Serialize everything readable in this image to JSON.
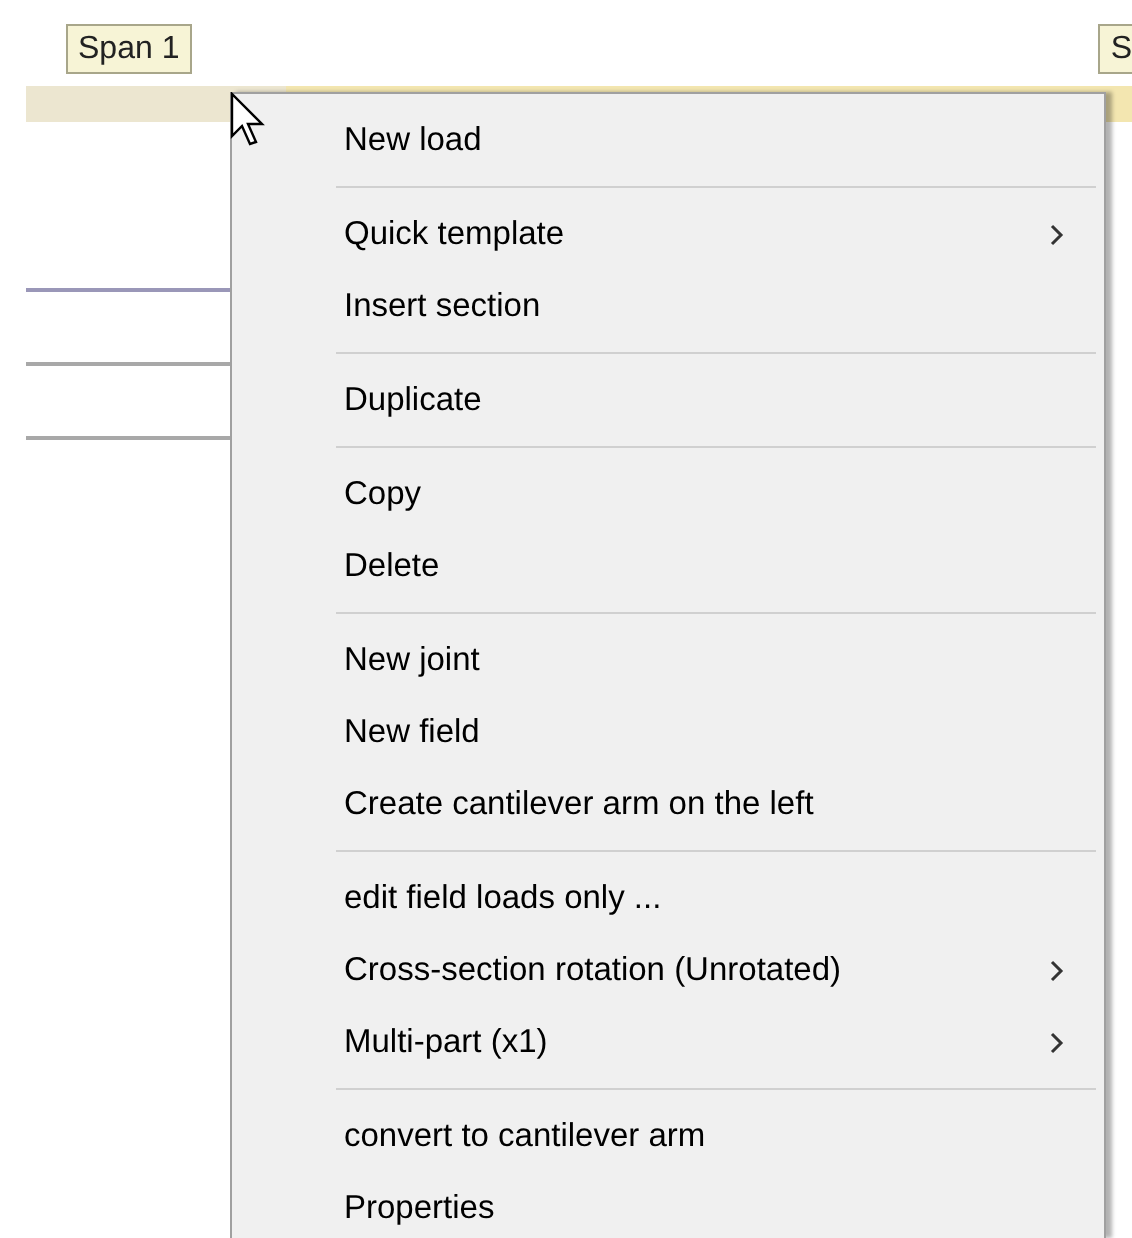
{
  "span_tags": [
    {
      "label": "Span 1"
    },
    {
      "label": "S"
    }
  ],
  "context_menu": {
    "items": [
      {
        "kind": "item",
        "label": "New load",
        "submenu": false
      },
      {
        "kind": "separator"
      },
      {
        "kind": "item",
        "label": "Quick template",
        "submenu": true
      },
      {
        "kind": "item",
        "label": "Insert section",
        "submenu": false
      },
      {
        "kind": "separator"
      },
      {
        "kind": "item",
        "label": "Duplicate",
        "submenu": false
      },
      {
        "kind": "separator"
      },
      {
        "kind": "item",
        "label": "Copy",
        "submenu": false
      },
      {
        "kind": "item",
        "label": "Delete",
        "submenu": false
      },
      {
        "kind": "separator"
      },
      {
        "kind": "item",
        "label": "New joint",
        "submenu": false
      },
      {
        "kind": "item",
        "label": "New field",
        "submenu": false
      },
      {
        "kind": "item",
        "label": "Create cantilever arm on the left",
        "submenu": false
      },
      {
        "kind": "separator"
      },
      {
        "kind": "item",
        "label": "edit field loads only ...",
        "submenu": false
      },
      {
        "kind": "item",
        "label": "Cross-section rotation (Unrotated)",
        "submenu": true
      },
      {
        "kind": "item",
        "label": "Multi-part (x1)",
        "submenu": true
      },
      {
        "kind": "separator"
      },
      {
        "kind": "item",
        "label": "convert to cantilever arm",
        "submenu": false
      },
      {
        "kind": "item",
        "label": "Properties",
        "submenu": false
      }
    ]
  }
}
